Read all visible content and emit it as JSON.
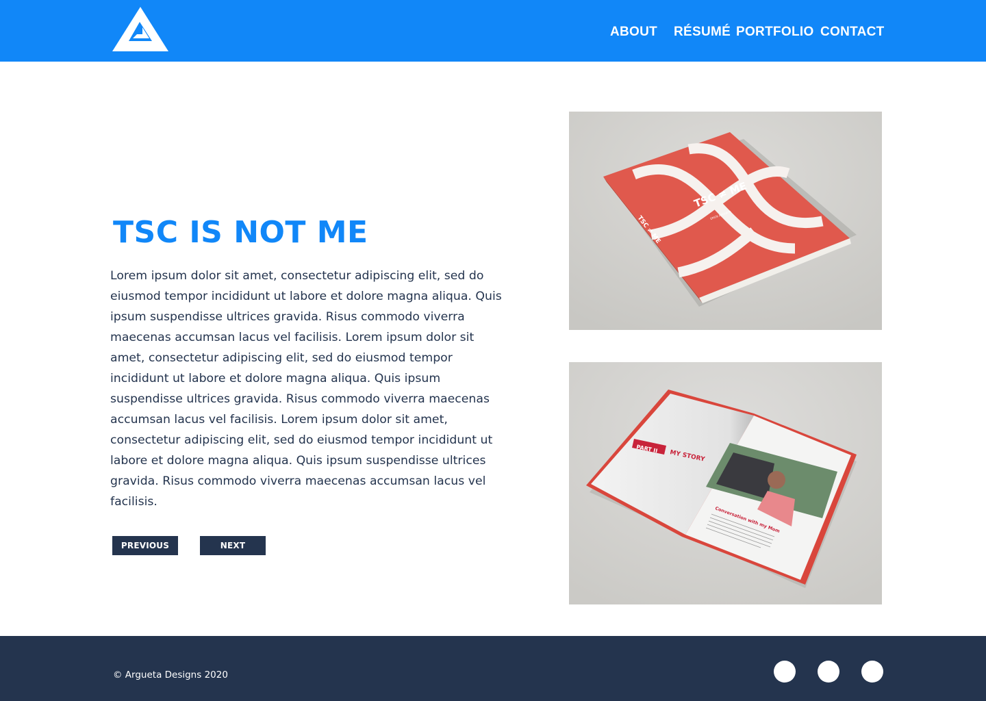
{
  "brand": {
    "logo_icon": "triangle-logo-icon",
    "colors": {
      "primary": "#1187f8",
      "dark": "#24344e",
      "white": "#ffffff"
    }
  },
  "nav": {
    "about": "ABOUT",
    "resume": "RÉSUMÉ",
    "portfolio": "PORTFOLIO",
    "contact": "CONTACT"
  },
  "project": {
    "title": "TSC IS NOT ME",
    "description": "Lorem ipsum dolor sit amet, consectetur adipiscing elit, sed do eiusmod tempor incididunt ut labore et dolore magna aliqua. Quis ipsum suspendisse ultrices gravida. Risus commodo viverra maecenas accumsan lacus vel facilisis. Lorem ipsum dolor sit amet, consectetur adipiscing elit, sed do eiusmod tempor incididunt ut labore et dolore magna aliqua. Quis ipsum suspendisse ultrices gravida. Risus commodo viverra maecenas accumsan lacus vel facilisis. Lorem ipsum dolor sit amet, consectetur adipiscing elit, sed do eiusmod tempor incididunt ut labore et dolore magna aliqua. Quis ipsum suspendisse ultrices gravida. Risus commodo viverra maecenas accumsan lacus vel facilisis.",
    "previous_label": "PREVIOUS",
    "next_label": "NEXT"
  },
  "mockups": {
    "cover": {
      "title": "TSC ≠ ME",
      "author": "ERICK ARGUETA",
      "spine": "TSC ≠ ME"
    },
    "spread": {
      "part": "PART II",
      "section": "MY STORY",
      "heading": "Conversation with my Mom"
    }
  },
  "footer": {
    "copyright": "© Argueta Designs 2020",
    "social_icons": [
      "social-icon-1",
      "social-icon-2",
      "social-icon-3"
    ]
  }
}
